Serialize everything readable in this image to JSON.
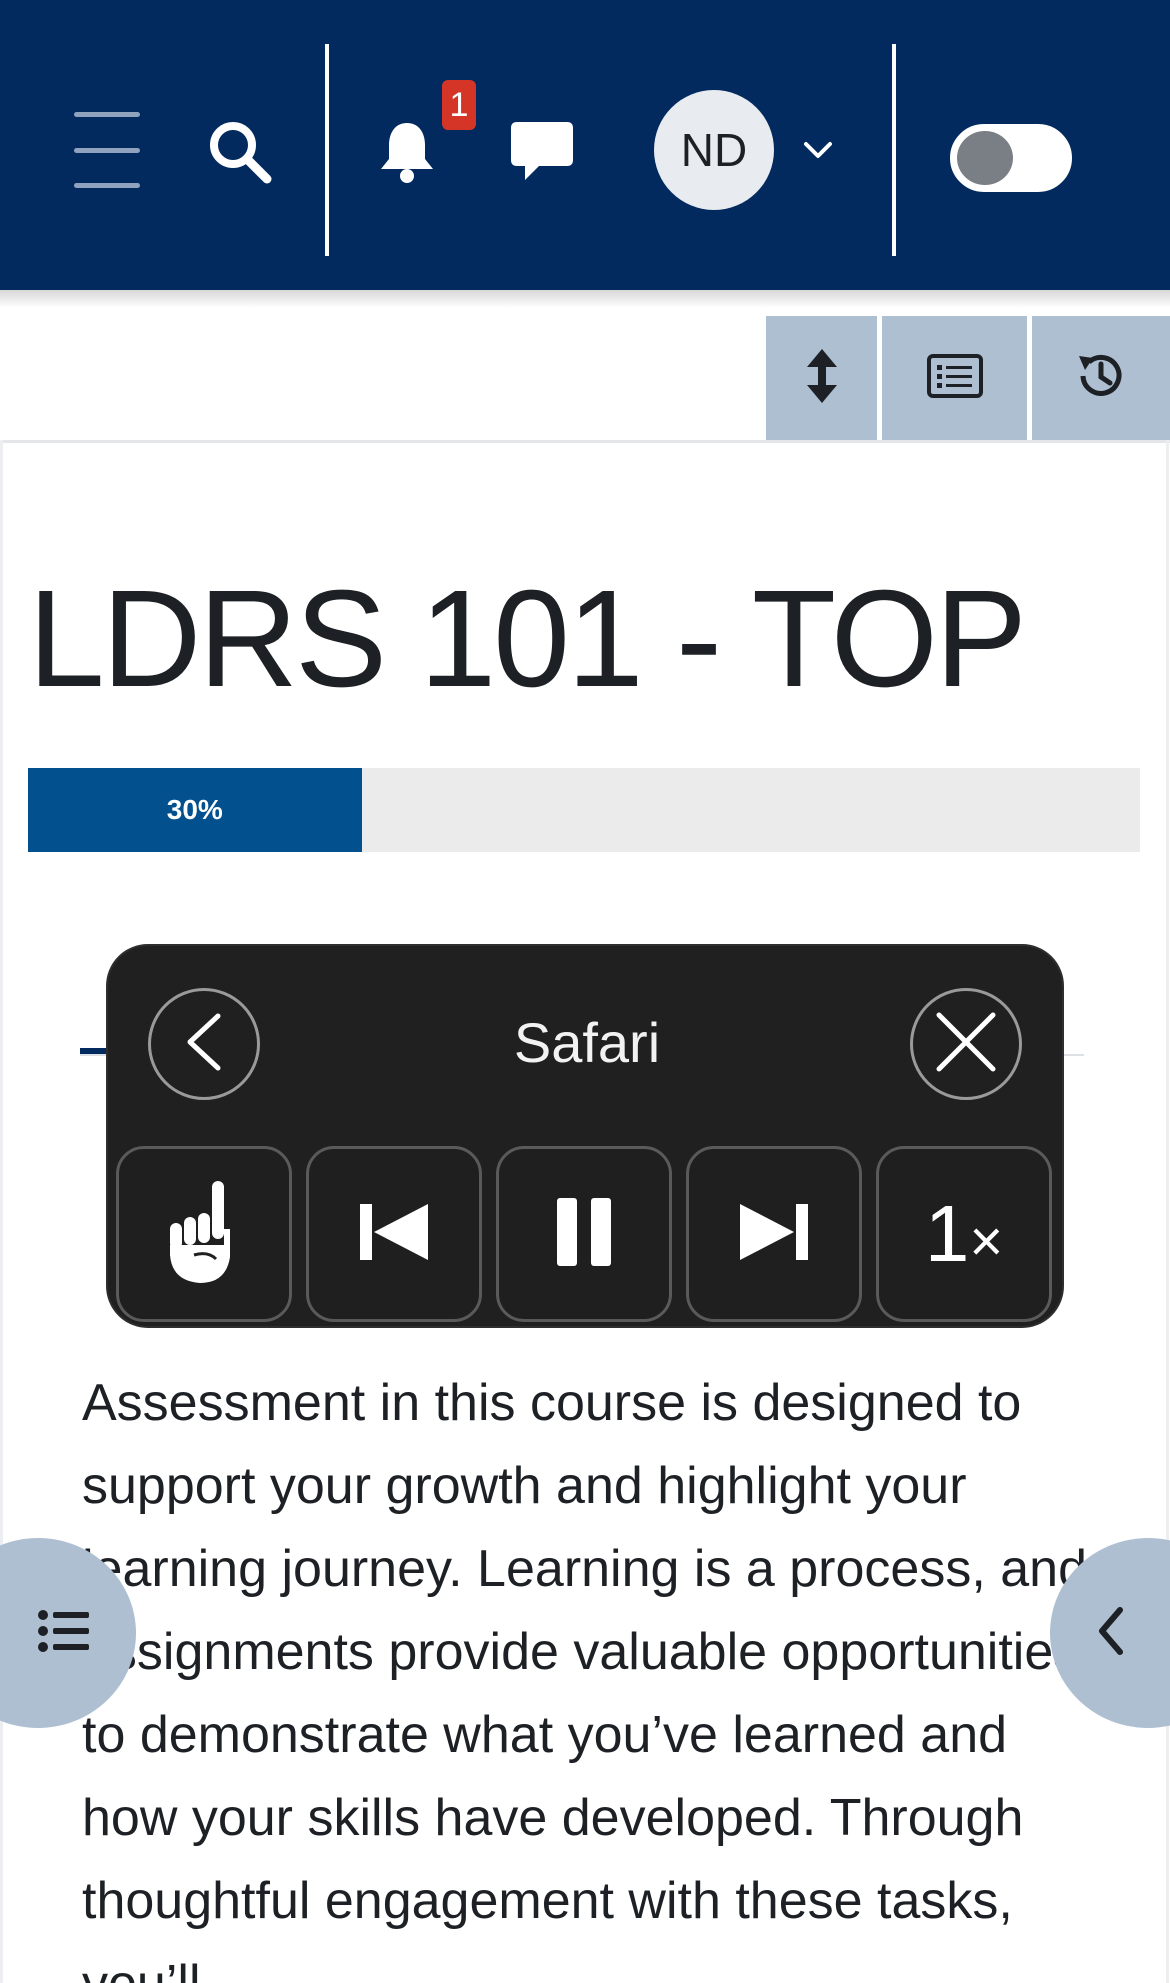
{
  "navbar": {
    "menu_icon": "hamburger-icon",
    "search_icon": "search-icon",
    "notifications_icon": "bell-icon",
    "notification_count": "1",
    "messages_icon": "chat-icon",
    "user_initials": "ND",
    "user_menu_icon": "chevron-down-icon",
    "dark_mode_toggle": "off"
  },
  "toolbar": {
    "icons": [
      "expand-vertical-icon",
      "list-icon",
      "history-icon"
    ]
  },
  "course": {
    "title": "LDRS 101 - TOP",
    "progress_label": "30%",
    "progress_value": 30
  },
  "content": {
    "body": "Assessment in this course is designed to support your growth and highlight your learning journey. Learning is a process, and assignments provide valuable opportunities to demonstrate what you’ve learned and how your skills have developed. Through thoughtful engagement with these tasks, you’ll"
  },
  "speech_controller": {
    "title": "Safari",
    "rate": "1",
    "rate_suffix": "×",
    "icons": [
      "back-icon",
      "close-icon",
      "pointer-hand-icon",
      "skip-back-icon",
      "pause-icon",
      "skip-forward-icon"
    ]
  },
  "colors": {
    "navbar": "#022a5e",
    "progress_fill": "#02508d",
    "tool_button": "#aebfd2",
    "badge": "#d43527"
  }
}
